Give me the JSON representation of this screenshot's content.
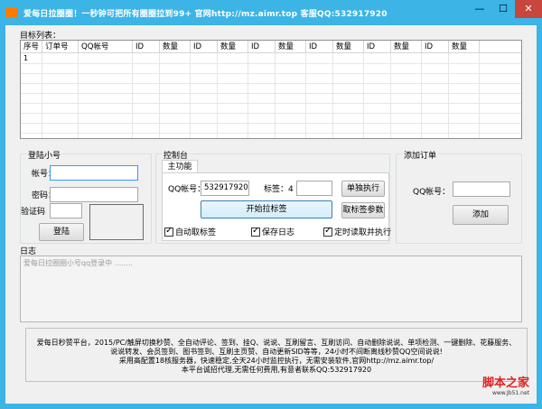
{
  "window": {
    "title": "爱每日拉圈圈！一秒钟可把所有圈圈拉到99+ 官网http://mz.aimr.top 客服QQ:532917920",
    "min_label": "—",
    "max_label": "☐",
    "close_label": "✕"
  },
  "target_list": {
    "label": "目标列表：",
    "columns": [
      "序号",
      "订单号",
      "QQ帐号",
      "ID",
      "数量",
      "ID",
      "数量",
      "ID",
      "数量",
      "ID",
      "数量",
      "ID",
      "数量",
      "ID",
      "数量"
    ],
    "rows": [
      [
        "1"
      ]
    ]
  },
  "login": {
    "title": "登陆小号",
    "account_label": "帐号：",
    "account_value": "",
    "password_label": "密码：",
    "password_value": "",
    "captcha_label": "验证码",
    "captcha_value": "",
    "login_button": "登陆"
  },
  "console": {
    "title": "控制台",
    "tab_main": "主功能",
    "qq_label": "QQ帐号：",
    "qq_value": "532917920",
    "tag_label": "标签：4",
    "tag_value": "",
    "single_button": "单独执行",
    "start_button": "开始拉标签",
    "params_button": "取标签参数",
    "auto_tag_label": "自动取标签",
    "save_log_label": "保存日志",
    "timer_label": "定时读取并执行"
  },
  "add_order": {
    "title": "添加订单",
    "qq_label": "QQ帐号：",
    "qq_value": "",
    "add_button": "添加"
  },
  "log": {
    "label": "日志",
    "text": "爱每日拉圈圈小号qq登录中 ........"
  },
  "info": {
    "lines": [
      "爱每日秒赞平台，2015/PC/触屏切换秒赞、全自动评论、签到、挂Q、说说、互刷留言、互刷访问、自动删除说说、单项检测、一键删除、花藤服务、",
      "说说转发、会员签到、图书签到、互刷主页赞、自动更新SID等等，24小时不间断离线秒赞QQ空间说说!",
      "采用高配置18核服务器，快速稳定,全天24小时监控执行，无需安装软件,官网http://mz.aimr.top/",
      "本平台诚招代理,无需任何费用,有意者联系QQ:532917920"
    ]
  },
  "watermark": {
    "main": "脚本之家",
    "sub": "www.Jb51.net"
  }
}
